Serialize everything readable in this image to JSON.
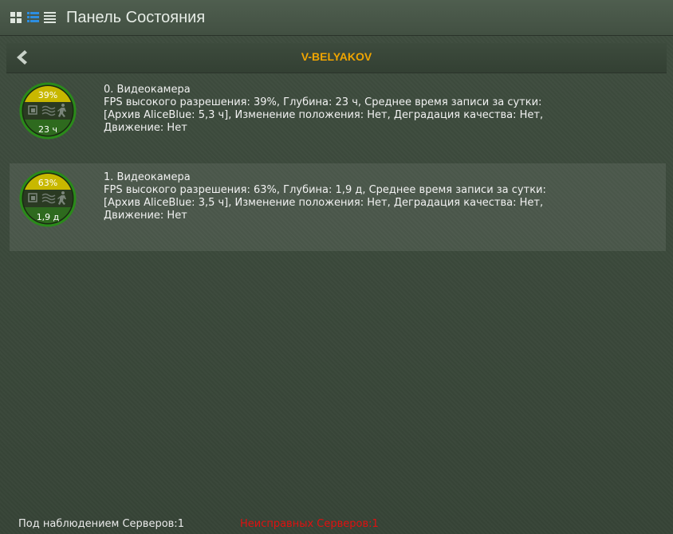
{
  "window": {
    "title": "Панель Состояния"
  },
  "server": {
    "name": "V-BELYAKOV"
  },
  "colors": {
    "accent": "#f0a500",
    "gauge_top": "#c8b800",
    "gauge_bottom": "#2e6a1e",
    "error": "#e01010"
  },
  "cameras": [
    {
      "percent_label": "39%",
      "depth_label": "23 ч",
      "name": "0. Видеокамера",
      "line1": "FPS высокого разрешения: 39%, Глубина: 23 ч, Среднее время записи за сутки:",
      "line2": "[Архив AliceBlue: 5,3 ч], Изменение положения: Нет, Деградация качества: Нет,",
      "line3": "Движение: Нет"
    },
    {
      "percent_label": "63%",
      "depth_label": "1,9 д",
      "name": "1. Видеокамера",
      "line1": "FPS высокого разрешения: 63%, Глубина: 1,9 д, Среднее время записи за сутки:",
      "line2": "[Архив AliceBlue: 3,5 ч], Изменение положения: Нет, Деградация качества: Нет,",
      "line3": "Движение: Нет"
    }
  ],
  "footer": {
    "monitored": "Под наблюдением Серверов:1",
    "faulty": "Неисправных Серверов:1"
  },
  "icons": [
    "grid-view-icon",
    "list-view-icon",
    "detail-view-icon",
    "back-arrow-icon",
    "archive-icon",
    "signal-icon",
    "motion-icon"
  ]
}
